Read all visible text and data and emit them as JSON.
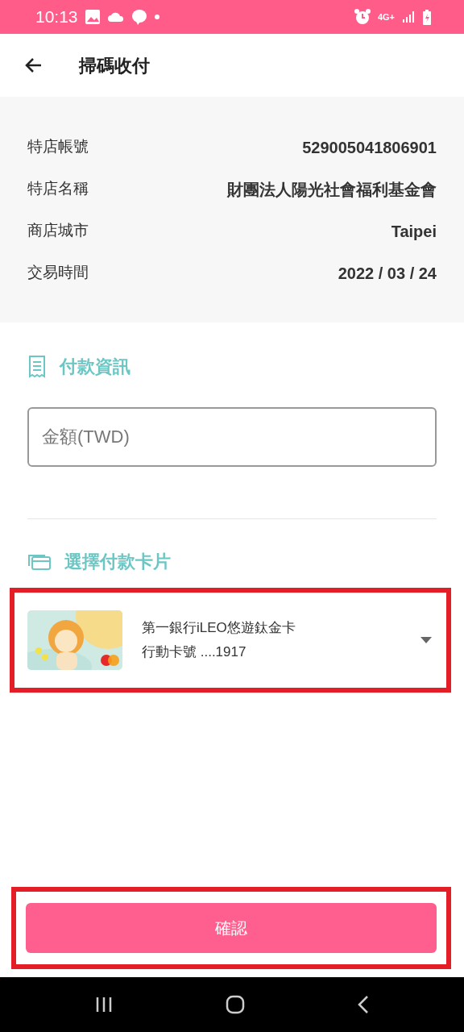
{
  "status_bar": {
    "time": "10:13",
    "network": "4G+"
  },
  "header": {
    "title": "掃碼收付"
  },
  "merchant_info": [
    {
      "label": "特店帳號",
      "value": "529005041806901"
    },
    {
      "label": "特店名稱",
      "value": "財團法人陽光社會福利基金會"
    },
    {
      "label": "商店城市",
      "value": "Taipei"
    },
    {
      "label": "交易時間",
      "value": "2022 / 03 / 24"
    }
  ],
  "payment_section": {
    "title": "付款資訊",
    "amount_field": {
      "placeholder": "金額(TWD)"
    }
  },
  "card_section": {
    "title": "選擇付款卡片",
    "card": {
      "name": "第一銀行iLEO悠遊鈦金卡",
      "number": "行動卡號 ....1917",
      "highlighted": true
    }
  },
  "confirm_button": {
    "label": "確認",
    "highlighted": true
  }
}
